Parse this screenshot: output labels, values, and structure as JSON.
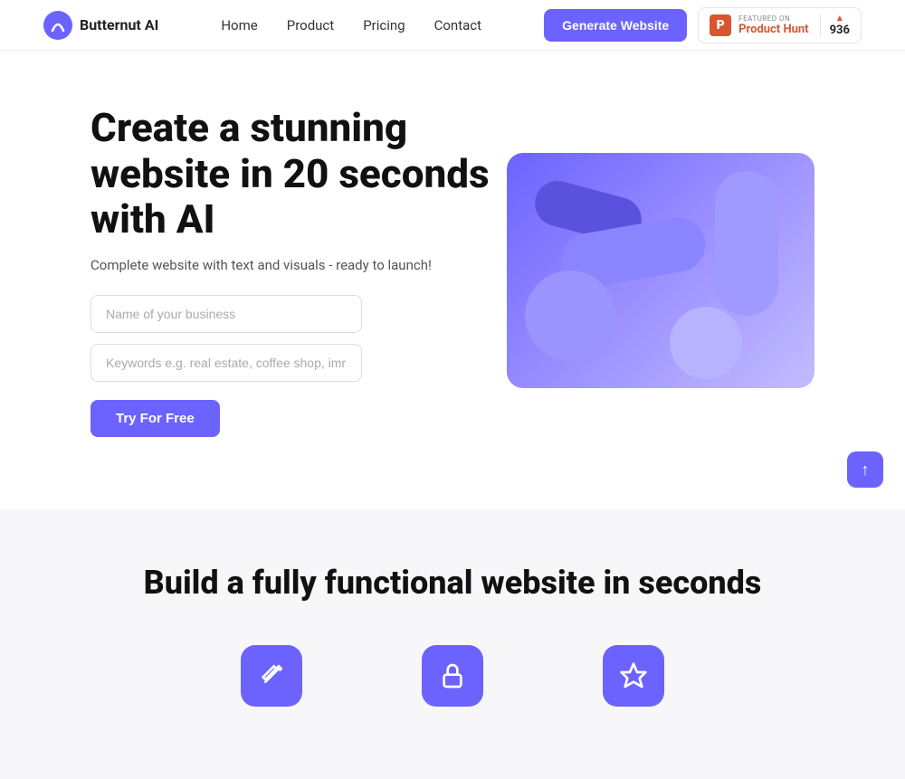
{
  "nav": {
    "brand_name": "Butternut AI",
    "links": [
      {
        "label": "Home",
        "href": "#"
      },
      {
        "label": "Product",
        "href": "#"
      },
      {
        "label": "Pricing",
        "href": "#"
      },
      {
        "label": "Contact",
        "href": "#"
      }
    ],
    "generate_button": "Generate Website",
    "product_hunt": {
      "featured_text": "FEATURED ON",
      "name": "Product Hunt",
      "score": "936"
    }
  },
  "hero": {
    "title": "Create a stunning website in 20 seconds with AI",
    "subtitle": "Complete website with text and visuals - ready to launch!",
    "input1_placeholder": "Name of your business",
    "input2_placeholder": "Keywords e.g. real estate, coffee shop, imr",
    "cta_button": "Try For Free"
  },
  "section2": {
    "title": "Build a fully functional website in seconds",
    "features": [
      {
        "icon": "wand",
        "label": ""
      },
      {
        "icon": "lock",
        "label": ""
      },
      {
        "icon": "star",
        "label": ""
      }
    ]
  },
  "scroll_top": "↑"
}
